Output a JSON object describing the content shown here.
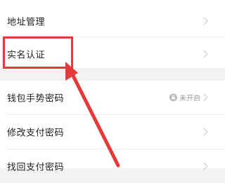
{
  "settings": {
    "group1": {
      "address": {
        "label": "地址管理"
      },
      "real_name": {
        "label": "实名认证"
      }
    },
    "group2": {
      "wallet_gesture": {
        "label": "钱包手势密码",
        "status": "未开启"
      },
      "change_payment": {
        "label": "修改支付密码"
      },
      "recover_payment": {
        "label": "找回支付密码"
      }
    }
  },
  "annotation": {
    "color": "#e23b3b"
  }
}
